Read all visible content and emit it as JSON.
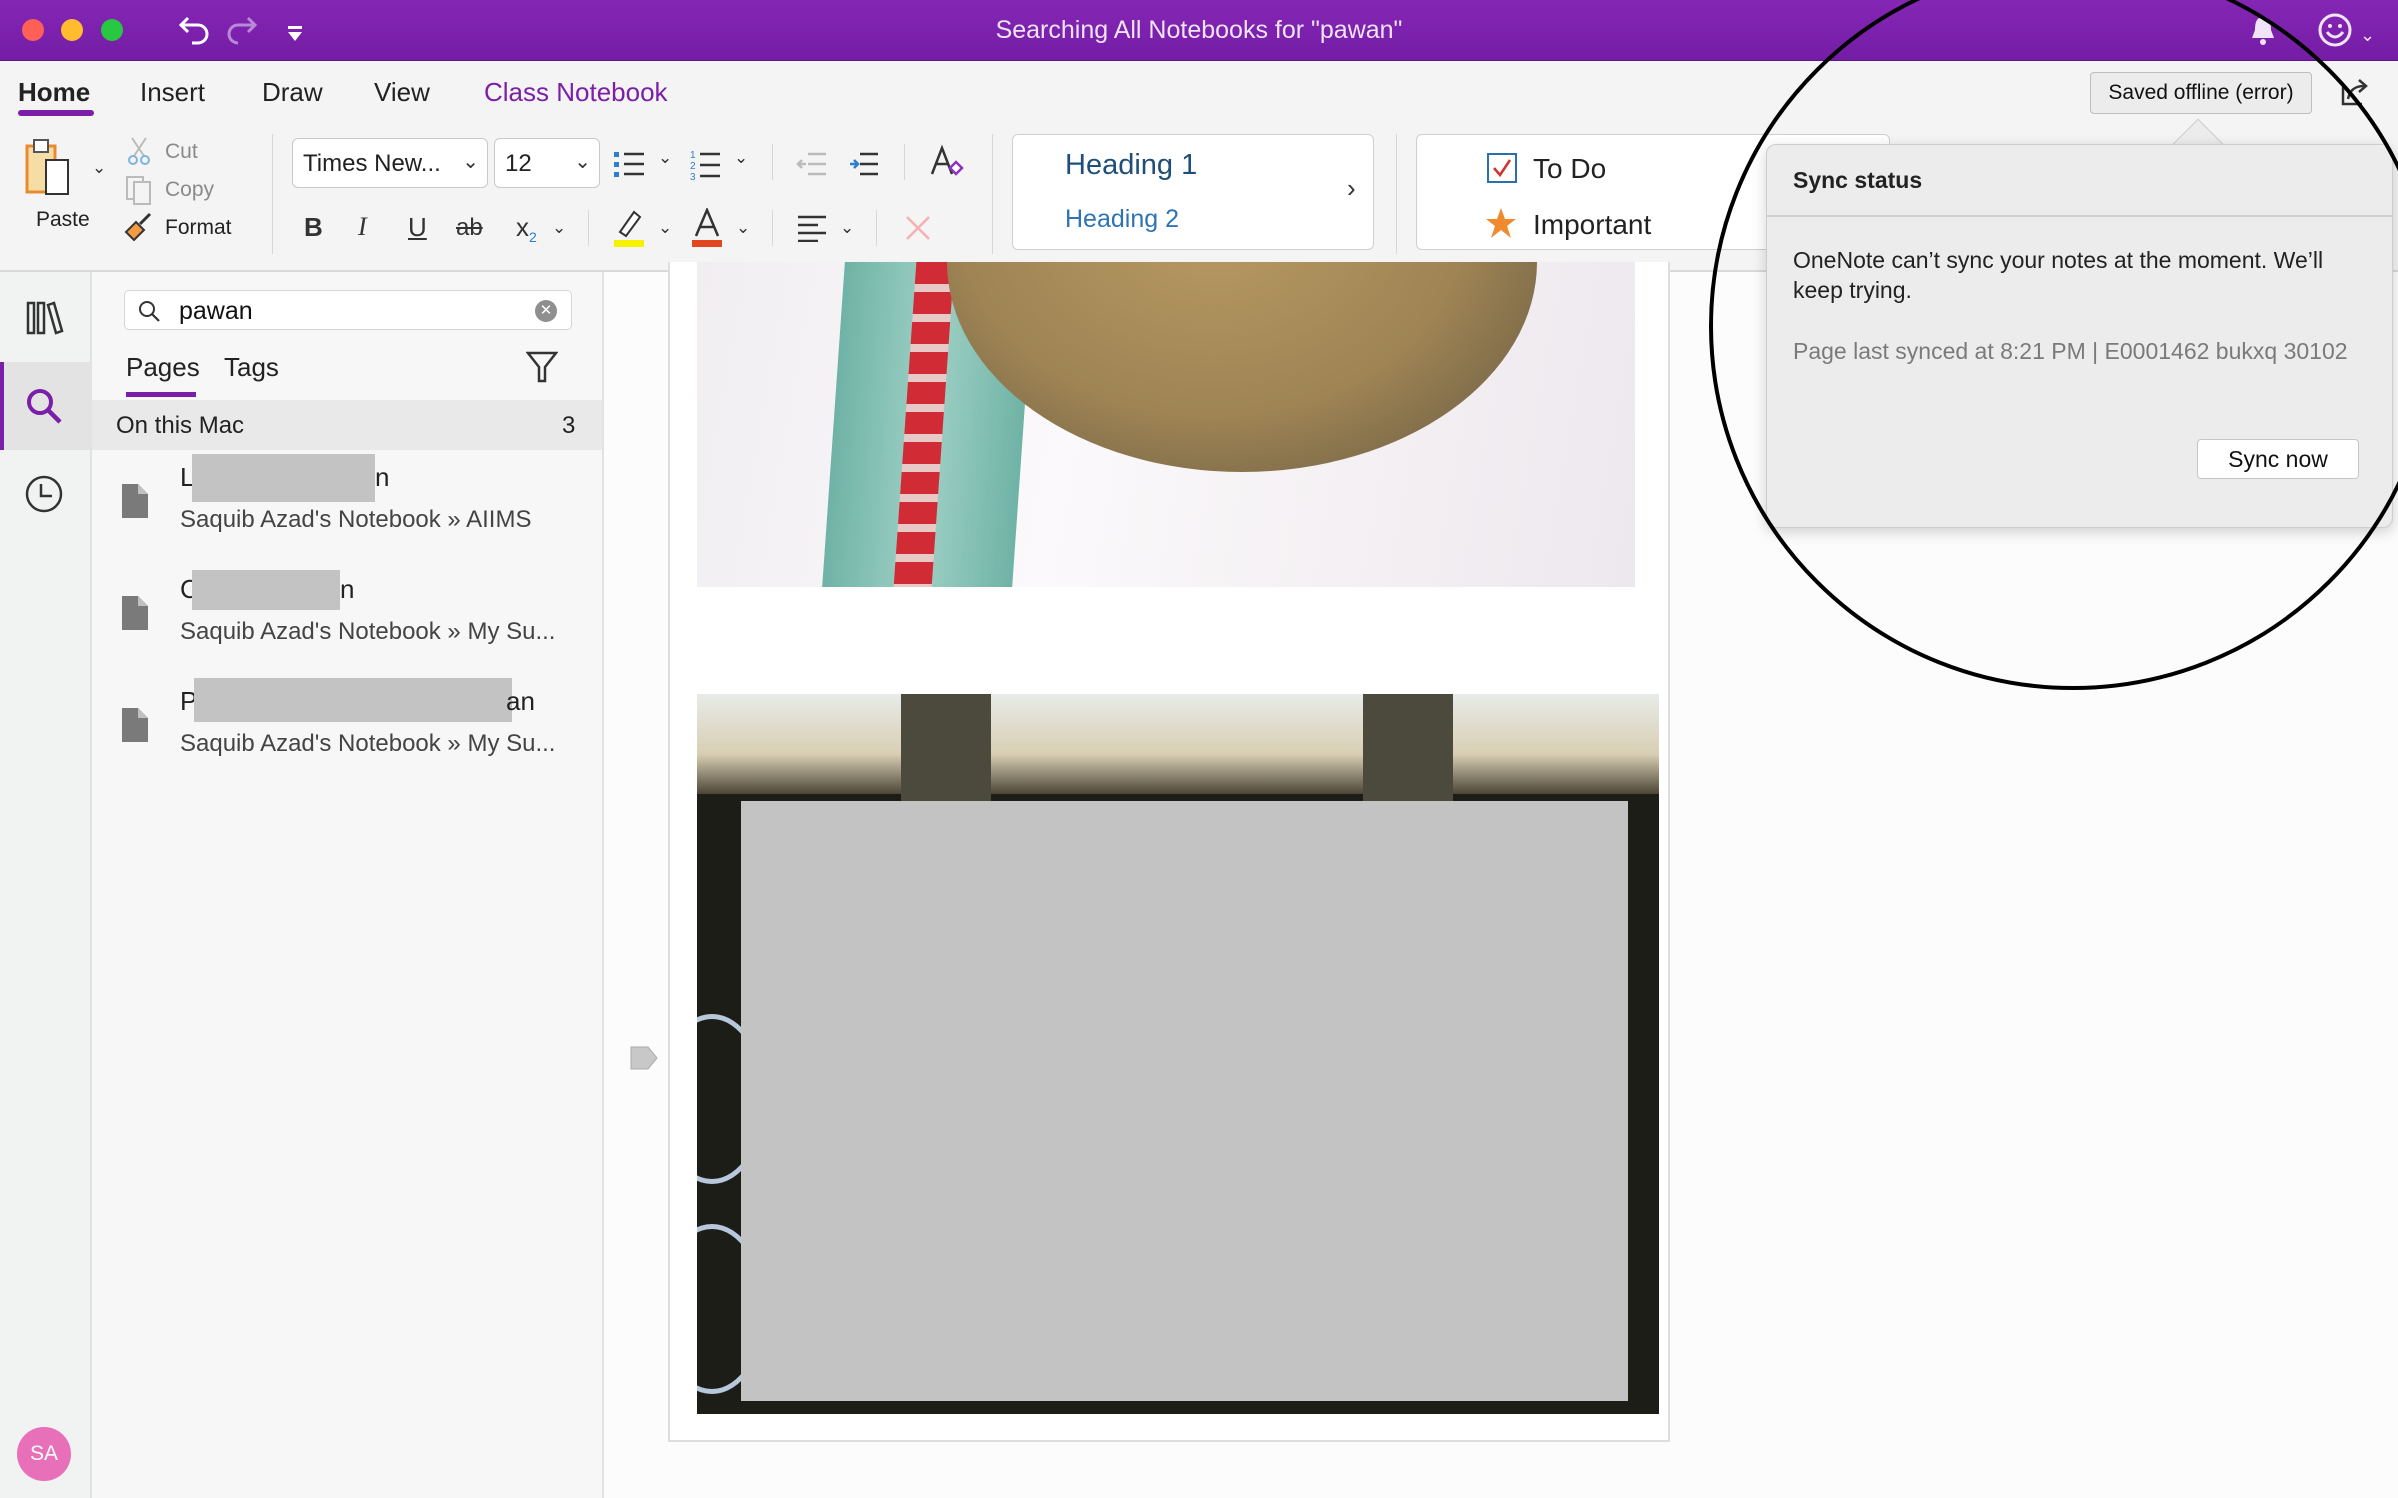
{
  "window": {
    "title": "Searching All Notebooks for \"pawan\"",
    "accent_color": "#7b1fa8"
  },
  "ribbon_tabs": [
    {
      "label": "Home",
      "active": true
    },
    {
      "label": "Insert",
      "active": false
    },
    {
      "label": "Draw",
      "active": false
    },
    {
      "label": "View",
      "active": false
    },
    {
      "label": "Class Notebook",
      "active": false
    }
  ],
  "clipboard": {
    "paste": "Paste",
    "cut": "Cut",
    "copy": "Copy",
    "format": "Format"
  },
  "font": {
    "family": "Times New...",
    "size": "12"
  },
  "format_buttons": {
    "bold": "B",
    "italic": "I",
    "underline": "U",
    "strikethrough": "ab",
    "subscript": "x",
    "subscript_index": "2",
    "font_color": "A",
    "highlight_color": "#f7f000",
    "font_color_bar": "#e2461e"
  },
  "styles": {
    "heading1": "Heading 1",
    "heading2": "Heading 2",
    "more": "›"
  },
  "tags": {
    "todo": "To Do",
    "important": "Important"
  },
  "status": {
    "saved_label": "Saved offline (error)"
  },
  "sync_popup": {
    "title": "Sync status",
    "message": "OneNote can’t sync your notes at the moment. We’ll keep trying.",
    "detail": "Page last synced at 8:21 PM | E0001462 bukxq 30102",
    "button": "Sync now"
  },
  "search": {
    "query": "pawan",
    "tabs": [
      {
        "label": "Pages",
        "active": true
      },
      {
        "label": "Tags",
        "active": false
      }
    ],
    "group_label": "On this Mac",
    "group_count": "3",
    "results": [
      {
        "title_start": "L",
        "title_end": "n",
        "path": "Saquib Azad's Notebook » AIIMS"
      },
      {
        "title_start": "C",
        "title_end": "n",
        "path": "Saquib Azad's Notebook » My Su..."
      },
      {
        "title_start": "P",
        "title_end": "an",
        "path": "Saquib Azad's Notebook » My Su..."
      }
    ]
  },
  "user": {
    "initials": "SA",
    "avatar_color": "#e870b8"
  }
}
